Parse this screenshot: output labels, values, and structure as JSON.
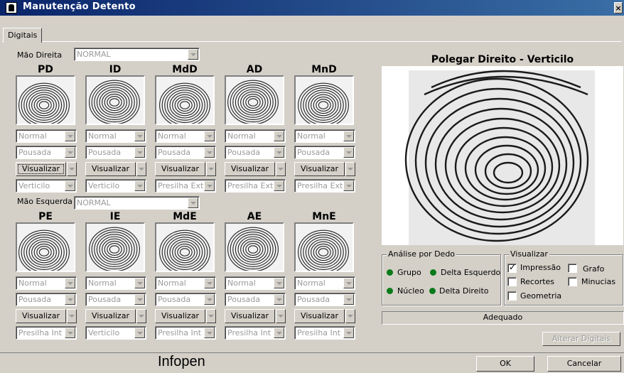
{
  "window": {
    "title": "Manutenção Detento",
    "close_glyph": "×"
  },
  "tabs": [
    {
      "label": "Digitais"
    }
  ],
  "right_hand": {
    "label": "Mão Direita",
    "combo_value": "NORMAL",
    "fingers": [
      {
        "label": "PD",
        "quality": "Normal",
        "state": "Pousada",
        "button": "Visualizar",
        "pattern": "Verticilo"
      },
      {
        "label": "ID",
        "quality": "Normal",
        "state": "Pousada",
        "button": "Visualizar",
        "pattern": "Verticilo"
      },
      {
        "label": "MdD",
        "quality": "Normal",
        "state": "Pousada",
        "button": "Visualizar",
        "pattern": "Presilha Ext"
      },
      {
        "label": "AD",
        "quality": "Normal",
        "state": "Pousada",
        "button": "Visualizar",
        "pattern": "Presilha Ext"
      },
      {
        "label": "MnD",
        "quality": "Normal",
        "state": "Pousada",
        "button": "Visualizar",
        "pattern": "Presilha Ext"
      }
    ]
  },
  "left_hand": {
    "label": "Mão Esquerda",
    "combo_value": "NORMAL",
    "fingers": [
      {
        "label": "PE",
        "quality": "Normal",
        "state": "Pousada",
        "button": "Visualizar",
        "pattern": "Presilha Int"
      },
      {
        "label": "IE",
        "quality": "Normal",
        "state": "Pousada",
        "button": "Visualizar",
        "pattern": "Verticilo"
      },
      {
        "label": "MdE",
        "quality": "Normal",
        "state": "Pousada",
        "button": "Visualizar",
        "pattern": "Presilha Int"
      },
      {
        "label": "AE",
        "quality": "Normal",
        "state": "Pousada",
        "button": "Visualizar",
        "pattern": "Presilha Int"
      },
      {
        "label": "MnE",
        "quality": "Normal",
        "state": "Pousada",
        "button": "Visualizar",
        "pattern": "Presilha Int"
      }
    ]
  },
  "preview": {
    "title": "Polegar Direito - Verticilo"
  },
  "analysis": {
    "legend": "Análise por Dedo",
    "items": [
      "Grupo",
      "Delta Esquerdo",
      "Núcleo",
      "Delta Direito"
    ],
    "dot_color": "#0a7a1a"
  },
  "visualize": {
    "legend": "Visualizar",
    "options": [
      {
        "label": "Impressão",
        "checked": true
      },
      {
        "label": "Grafo",
        "checked": false
      },
      {
        "label": "Recortes",
        "checked": false
      },
      {
        "label": "Minucias",
        "checked": false
      },
      {
        "label": "Geometria",
        "checked": false
      }
    ]
  },
  "status_text": "Adequado",
  "alter_button": "Alterar Digitais",
  "ok_button": "OK",
  "cancel_button": "Cancelar",
  "footer_brand": "Infopen"
}
